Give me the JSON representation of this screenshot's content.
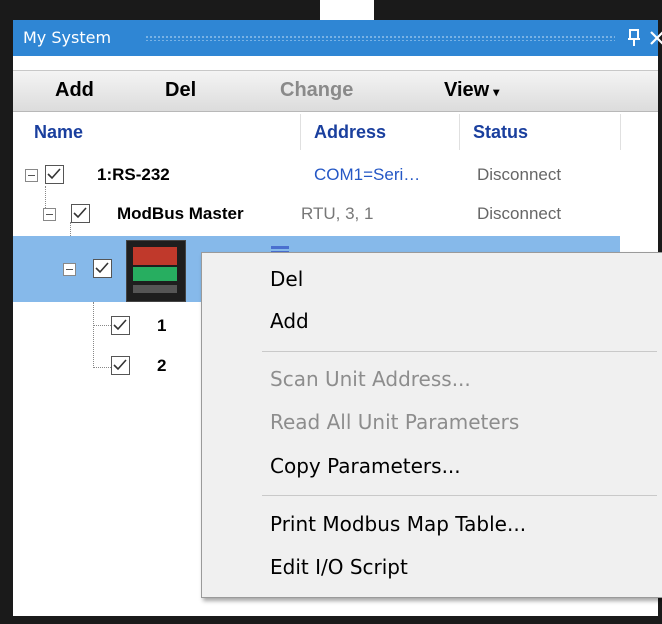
{
  "panel": {
    "title": "My System",
    "pin_icon": "pin-icon",
    "close_icon": "close-icon"
  },
  "toolbar": {
    "add_label": "Add",
    "del_label": "Del",
    "change_label": "Change",
    "view_label": "View",
    "view_arrow": "▾"
  },
  "columns": {
    "name": "Name",
    "address": "Address",
    "status": "Status"
  },
  "tree": {
    "rs232": {
      "label": "1:RS-232",
      "address": "COM1=Seri…",
      "status": "Disconnect"
    },
    "modbus": {
      "label": "ModBus Master",
      "params": "RTU, 3, 1",
      "status": "Disconnect"
    },
    "device": {
      "icon": "device-controller-icon"
    },
    "children": [
      "1",
      "2"
    ]
  },
  "context_menu": {
    "del": "Del",
    "add": "Add",
    "scan": "Scan Unit Address...",
    "read_all": "Read All Unit Parameters",
    "copy": "Copy Parameters...",
    "print": "Print Modbus Map Table...",
    "edit_io": "Edit I/O Script"
  },
  "colors": {
    "titlebar": "#2f86d4",
    "selection": "#86b9ea",
    "address_text": "#2457c5",
    "header_text": "#1a3f9e"
  }
}
